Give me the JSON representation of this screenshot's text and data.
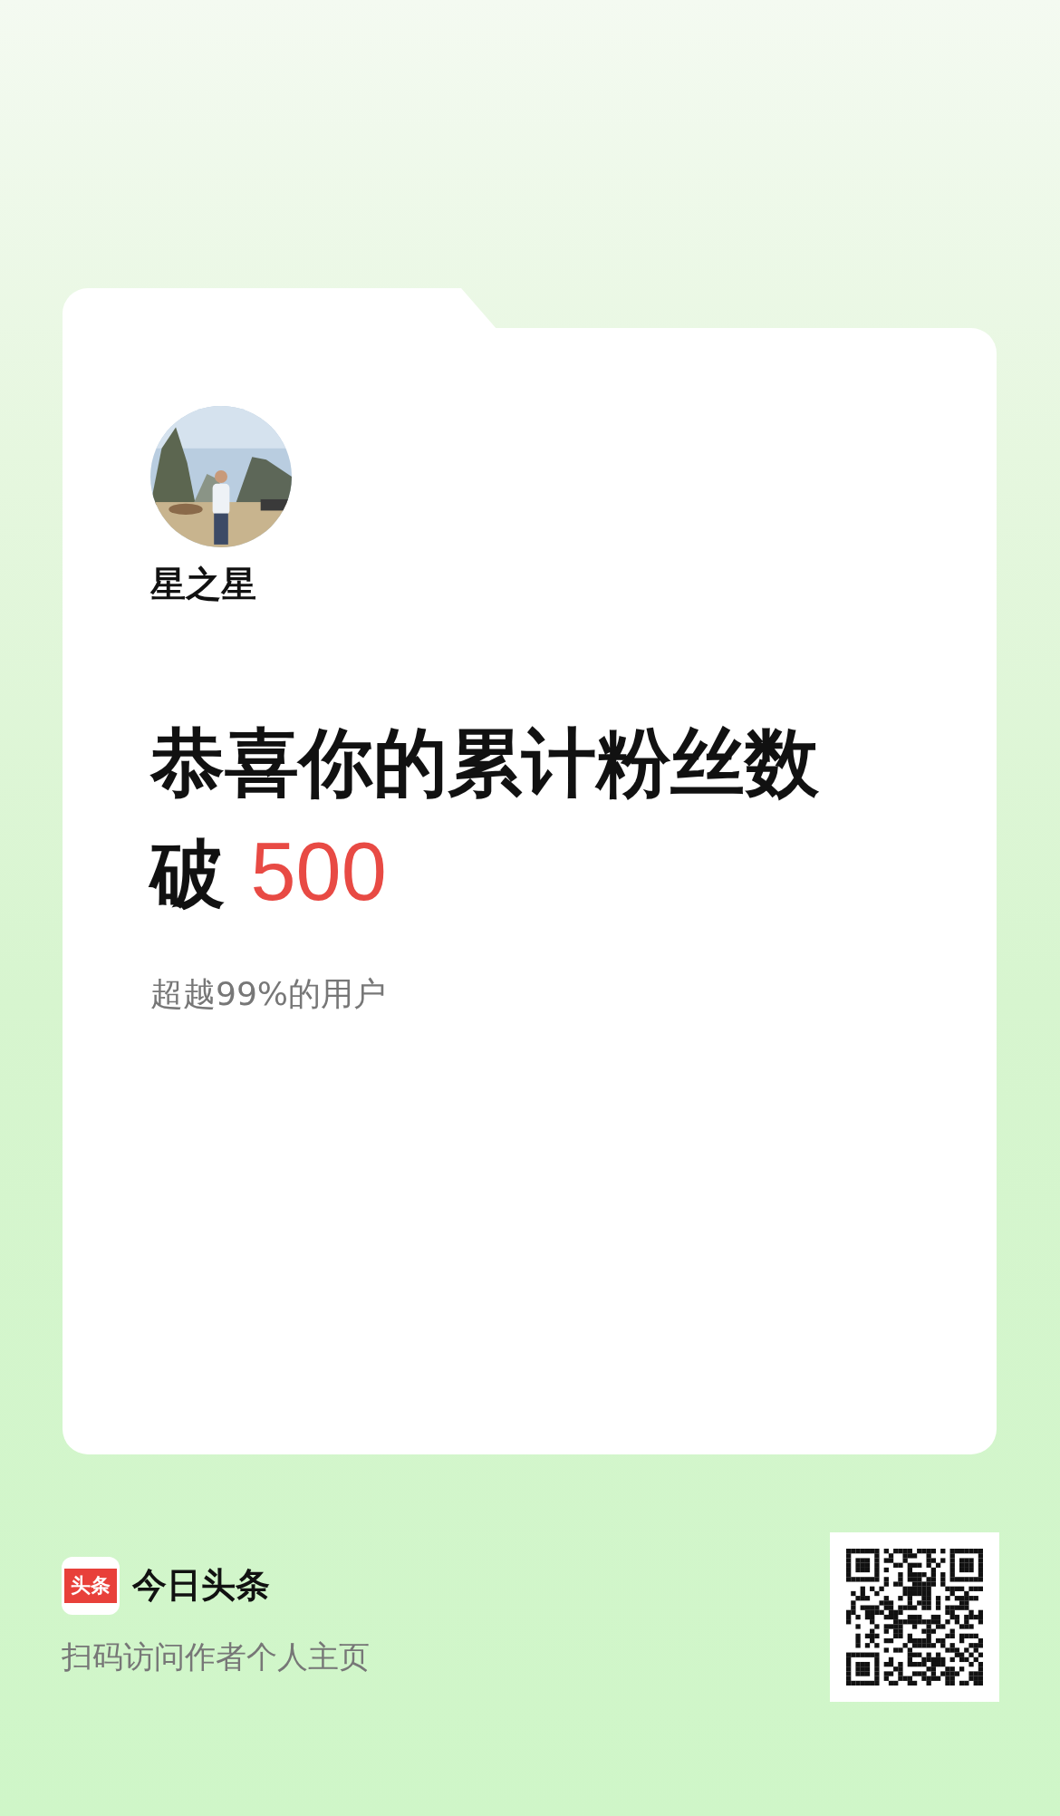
{
  "card": {
    "username": "星之星",
    "heading": {
      "line1": "恭喜你的累计粉丝数",
      "line2": "破",
      "highlight": "500"
    },
    "subtitle": "超越99%的用户"
  },
  "footer": {
    "logo_text": "头条",
    "brand": "今日头条",
    "caption": "扫码访问作者个人主页",
    "qr": {
      "kind": "qr"
    }
  }
}
